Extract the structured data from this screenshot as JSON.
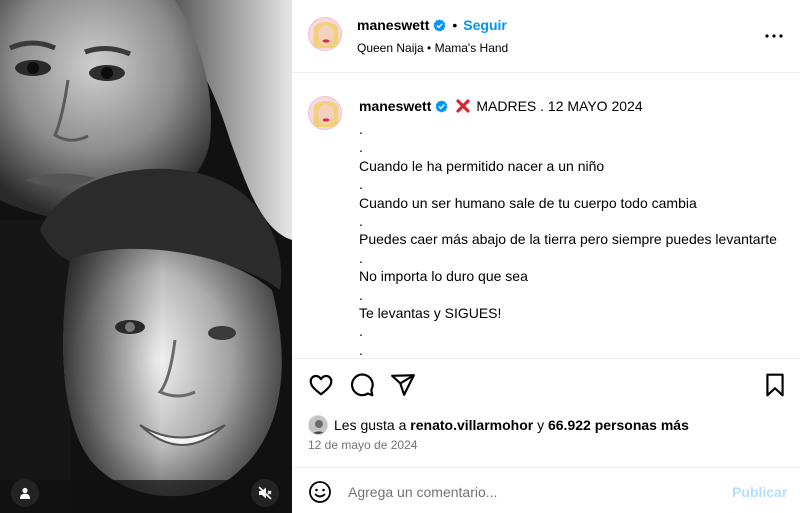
{
  "post": {
    "username": "maneswett",
    "follow_label": "Seguir",
    "separator": "•",
    "audio": "Queen Naija • Mama's Hand",
    "caption_title": "MADRES . 12 MAYO 2024",
    "caption_lines": [
      ".",
      ".",
      "Cuando le ha permitido nacer a un niño",
      ".",
      "Cuando un ser humano sale de tu cuerpo todo cambia",
      ".",
      "Puedes caer más abajo de la tierra pero siempre puedes levantarte",
      ".",
      "No importa lo duro que sea",
      ".",
      "Te levantas y SIGUES!",
      ".",
      "."
    ],
    "likes_prefix": "Les gusta a",
    "likes_user": "renato.villarmohor",
    "likes_conj": "y",
    "likes_rest": "66.922 personas más",
    "date": "12 de mayo de 2024"
  },
  "comment": {
    "placeholder": "Agrega un comentario...",
    "post_label": "Publicar"
  },
  "icons": {
    "verified": "verified-badge-icon",
    "more": "more-options-icon",
    "cross": "cross-mark-emoji-icon",
    "like": "heart-icon",
    "comment": "comment-bubble-icon",
    "share": "paper-plane-icon",
    "save": "bookmark-icon",
    "emoji": "smiley-icon",
    "tag": "person-tag-icon",
    "mute": "speaker-muted-icon"
  },
  "colors": {
    "accent": "#0095f6",
    "publish_disabled": "#b2dffc",
    "verified": "#0095f6",
    "cross": "#d9252f",
    "muted_text": "#737373"
  }
}
